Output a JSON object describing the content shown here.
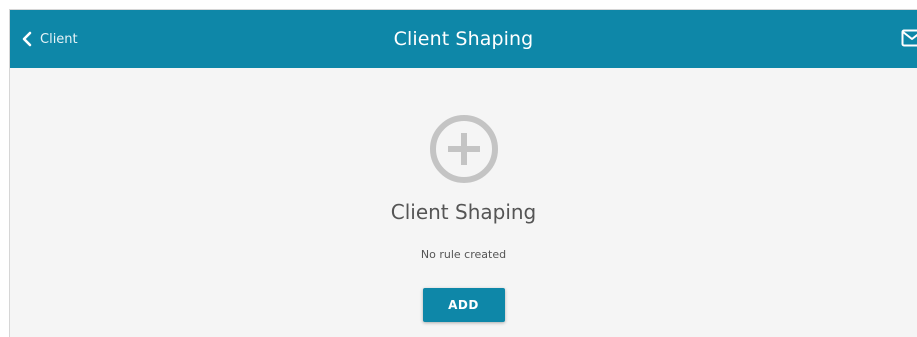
{
  "header": {
    "back_label": "Client",
    "title": "Client Shaping",
    "back_icon": "chevron-left-icon",
    "mail_icon": "envelope-icon"
  },
  "empty_state": {
    "icon": "circle-plus-icon",
    "heading": "Client Shaping",
    "message": "No rule created",
    "add_label": "ADD"
  },
  "colors": {
    "accent": "#0e87a8",
    "background": "#f5f5f5",
    "icon_gray": "#c4c4c4",
    "text": "#555555"
  }
}
